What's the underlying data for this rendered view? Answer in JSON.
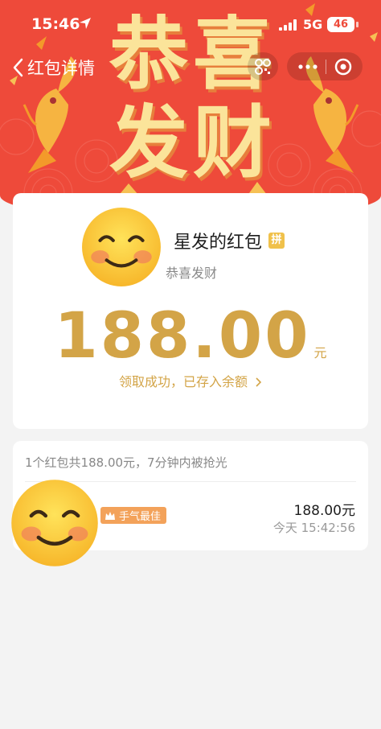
{
  "status_bar": {
    "time": "15:46",
    "network": "5G",
    "battery": "46"
  },
  "nav": {
    "title": "红包详情"
  },
  "banner": {
    "char1": "恭",
    "char2": "喜",
    "char3": "发",
    "char4": "财"
  },
  "packet": {
    "sender": "星发的红包",
    "pin_badge": "拼",
    "wish": "恭喜发财",
    "amount": "188.00",
    "unit": "元",
    "status": "领取成功，已存入余额"
  },
  "list": {
    "summary": "1个红包共188.00元，7分钟内被抢光",
    "items": [
      {
        "badge": "手气最佳",
        "amount": "188.00元",
        "time": "今天 15:42:56"
      }
    ]
  },
  "colors": {
    "header": "#ee4a3a",
    "gold": "#d3a447",
    "title_art": "#fbe49a"
  }
}
